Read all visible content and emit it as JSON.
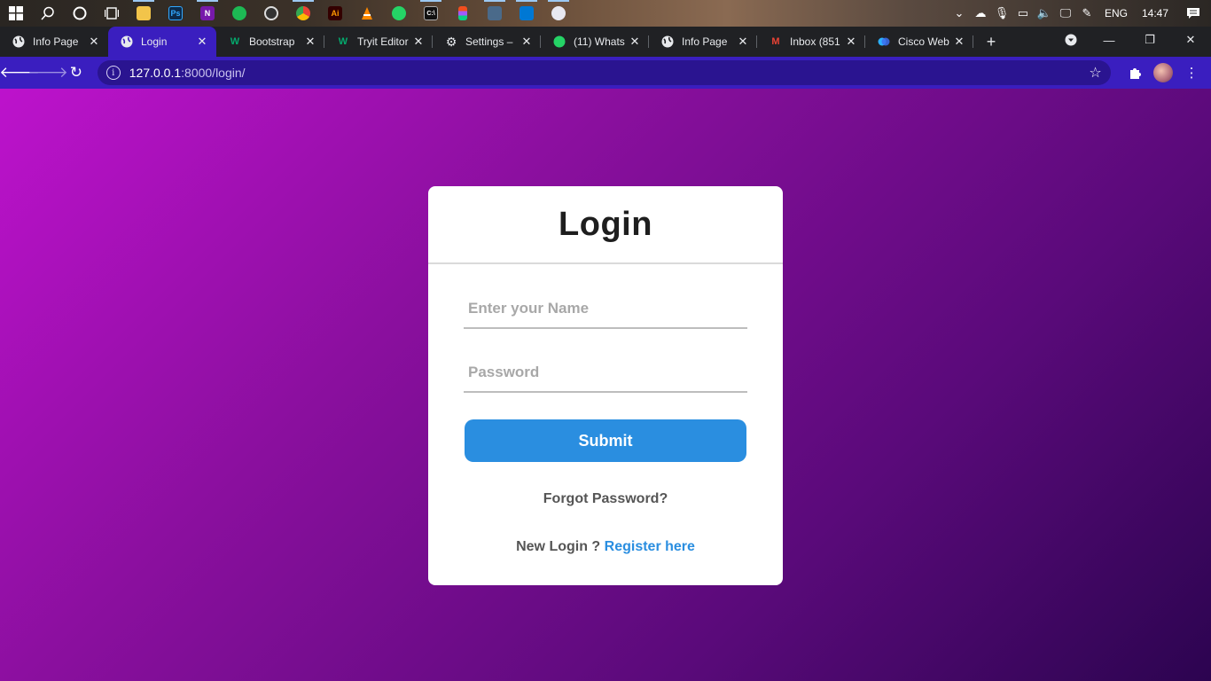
{
  "taskbar": {
    "icons": [
      {
        "name": "windows-start",
        "glyph": "⊞"
      },
      {
        "name": "search",
        "glyph": "⌕"
      },
      {
        "name": "cortana",
        "glyph": "○"
      },
      {
        "name": "task-view",
        "glyph": "▤"
      },
      {
        "name": "file-explorer",
        "glyph": ""
      },
      {
        "name": "photoshop",
        "glyph": "Ps"
      },
      {
        "name": "onenote",
        "glyph": "N"
      },
      {
        "name": "spotify",
        "glyph": ""
      },
      {
        "name": "obs",
        "glyph": ""
      },
      {
        "name": "chrome",
        "glyph": ""
      },
      {
        "name": "illustrator",
        "glyph": "Ai"
      },
      {
        "name": "vlc",
        "glyph": ""
      },
      {
        "name": "whatsapp",
        "glyph": ""
      },
      {
        "name": "terminal",
        "glyph": "C:\\"
      },
      {
        "name": "figma",
        "glyph": ""
      },
      {
        "name": "app-bird",
        "glyph": ""
      },
      {
        "name": "vscode",
        "glyph": ""
      },
      {
        "name": "paint",
        "glyph": ""
      }
    ],
    "language": "ENG",
    "time": "14:47"
  },
  "tabs": [
    {
      "title": "Info Page",
      "favicon": "globe"
    },
    {
      "title": "Login",
      "favicon": "globe",
      "active": true
    },
    {
      "title": "Bootstrap",
      "favicon": "w"
    },
    {
      "title": "Tryit Editor",
      "favicon": "w"
    },
    {
      "title": "Settings –",
      "favicon": "gear"
    },
    {
      "title": "(11) Whats",
      "favicon": "whatsapp"
    },
    {
      "title": "Info Page",
      "favicon": "globe"
    },
    {
      "title": "Inbox (851",
      "favicon": "gmail"
    },
    {
      "title": "Cisco Web",
      "favicon": "webex"
    }
  ],
  "address": {
    "host": "127.0.0.1",
    "path": ":8000/login/"
  },
  "login": {
    "title": "Login",
    "name_placeholder": "Enter your Name",
    "password_placeholder": "Password",
    "submit_label": "Submit",
    "forgot_label": "Forgot Password?",
    "new_login_text": "New Login ? ",
    "register_label": "Register here"
  },
  "colors": {
    "accent": "#2a8ee0",
    "toolbar": "#3a1ebf",
    "gradient_start": "#bd12cc",
    "gradient_end": "#2c0450"
  }
}
